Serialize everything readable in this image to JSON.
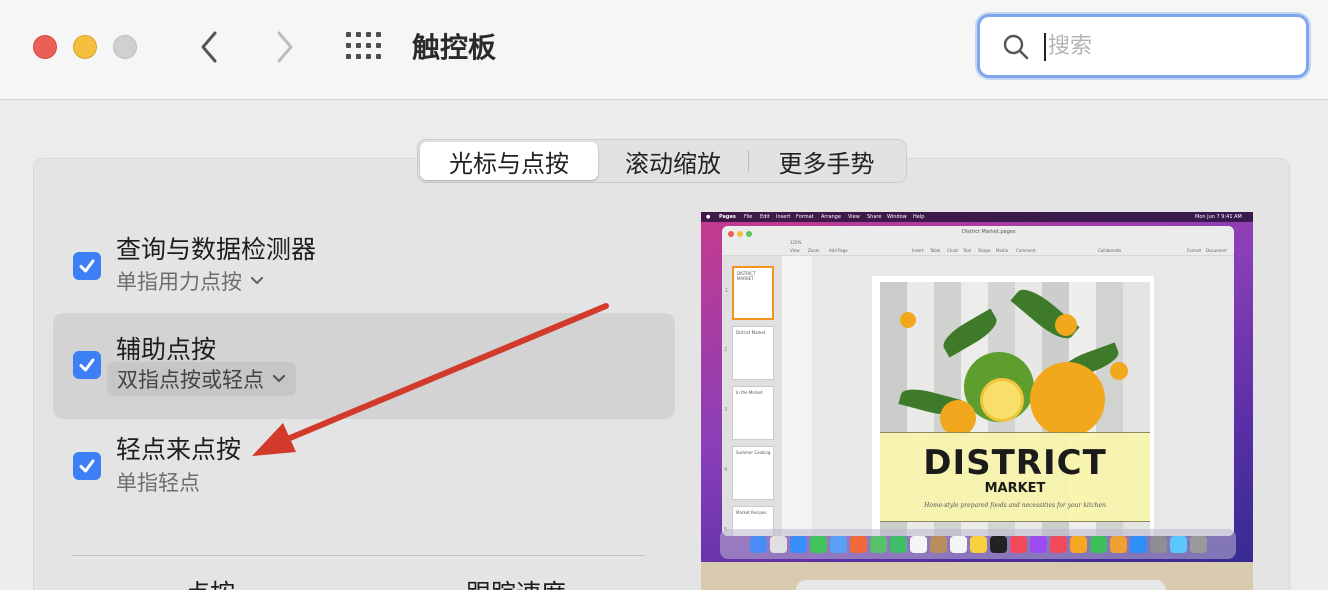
{
  "window": {
    "title": "触控板"
  },
  "search": {
    "placeholder": "搜索",
    "value": ""
  },
  "tabs": [
    {
      "label": "光标与点按",
      "selected": true
    },
    {
      "label": "滚动缩放",
      "selected": false
    },
    {
      "label": "更多手势",
      "selected": false
    }
  ],
  "options": [
    {
      "title": "查询与数据检测器",
      "subtitle": "单指用力点按",
      "checked": true
    },
    {
      "title": "辅助点按",
      "subtitle": "双指点按或轻点",
      "checked": true
    },
    {
      "title": "轻点来点按",
      "subtitle": "单指轻点",
      "checked": true
    }
  ],
  "bottom": {
    "left_label": "点按",
    "right_label": "跟踪速度"
  },
  "preview": {
    "menubar": {
      "app": "Pages",
      "items": [
        "File",
        "Edit",
        "Insert",
        "Format",
        "Arrange",
        "View",
        "Share",
        "Window",
        "Help"
      ],
      "clock": "Mon Jun 7 9:41 AM"
    },
    "document_title": "District Market.pages",
    "toolbar": {
      "zoom": "125%",
      "labels": [
        "View",
        "Zoom",
        "Add Page",
        "Insert",
        "Table",
        "Chart",
        "Text",
        "Shape",
        "Media",
        "Comment",
        "Collaborate",
        "Format",
        "Document"
      ]
    },
    "thumbnails": [
      {
        "num": "1",
        "title": "DISTRICT MARKET"
      },
      {
        "num": "2",
        "title": "District Market"
      },
      {
        "num": "3",
        "title": "In the Market"
      },
      {
        "num": "4",
        "title": "Summer Cooking"
      },
      {
        "num": "5",
        "title": "Market Recipes"
      }
    ],
    "cover": {
      "title": "DISTRICT",
      "subtitle": "MARKET",
      "tagline": "Home-style prepared foods and necessities for your kitchen"
    }
  },
  "colors": {
    "accent": "#3d7ff5",
    "close": "#ec5f57",
    "minimize": "#f4be3f",
    "annotation_arrow": "#d23a2b"
  }
}
